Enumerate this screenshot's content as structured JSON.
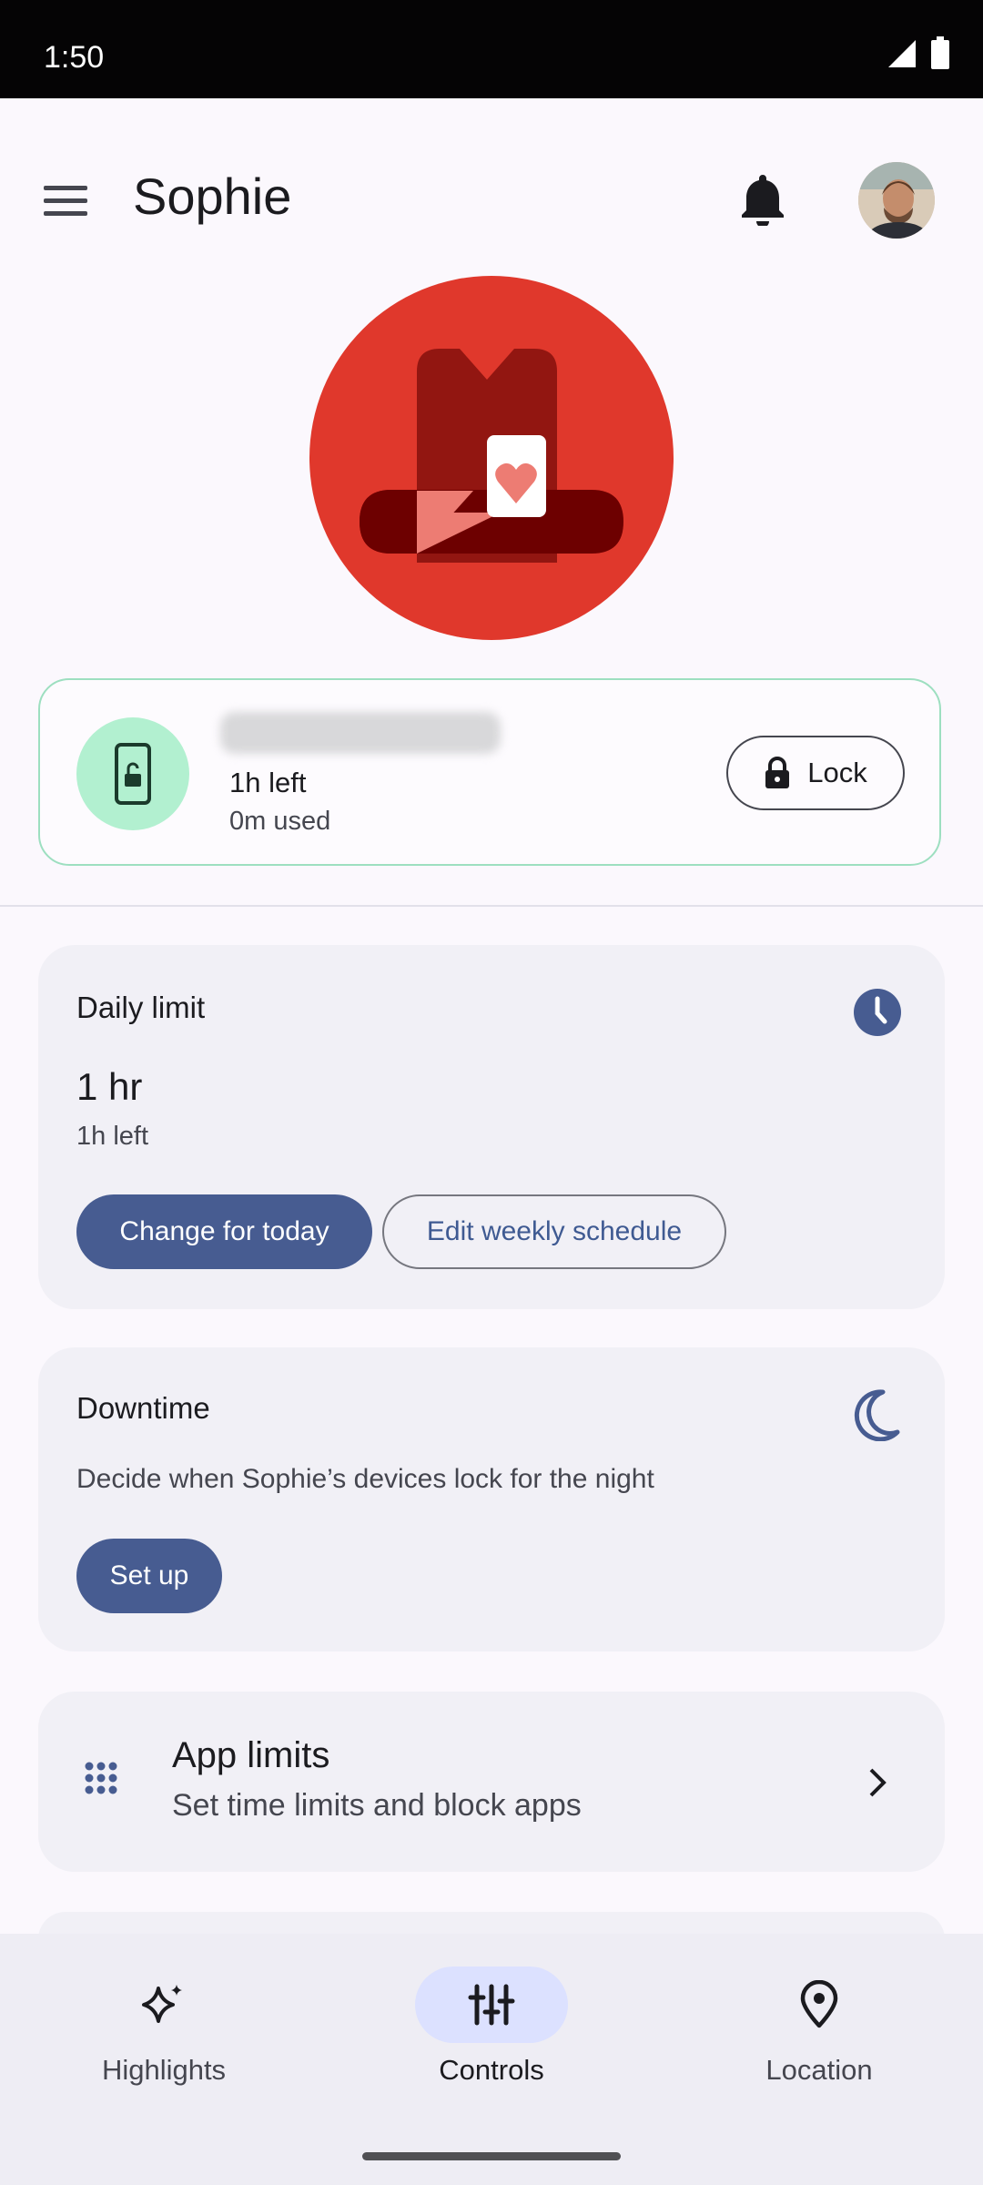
{
  "status_bar": {
    "time": "1:50"
  },
  "app_bar": {
    "title": "Sophie"
  },
  "device": {
    "time_left": "1h left",
    "time_used": "0m used",
    "lock_label": "Lock"
  },
  "daily_limit": {
    "title": "Daily limit",
    "value": "1 hr",
    "left": "1h left",
    "change_button": "Change for today",
    "edit_button": "Edit weekly schedule"
  },
  "downtime": {
    "title": "Downtime",
    "description": "Decide when Sophie’s devices lock for the night",
    "setup_button": "Set up"
  },
  "app_limits": {
    "title": "App limits",
    "subtitle": "Set time limits and block apps"
  },
  "bottom_nav": {
    "items": [
      {
        "label": "Highlights",
        "icon": "sparkle-icon"
      },
      {
        "label": "Controls",
        "icon": "sliders-icon",
        "active": true
      },
      {
        "label": "Location",
        "icon": "location-pin-icon"
      }
    ]
  },
  "colors": {
    "primary": "#475c91",
    "hero_red": "#e0382c",
    "device_green": "#b2f0d0"
  }
}
